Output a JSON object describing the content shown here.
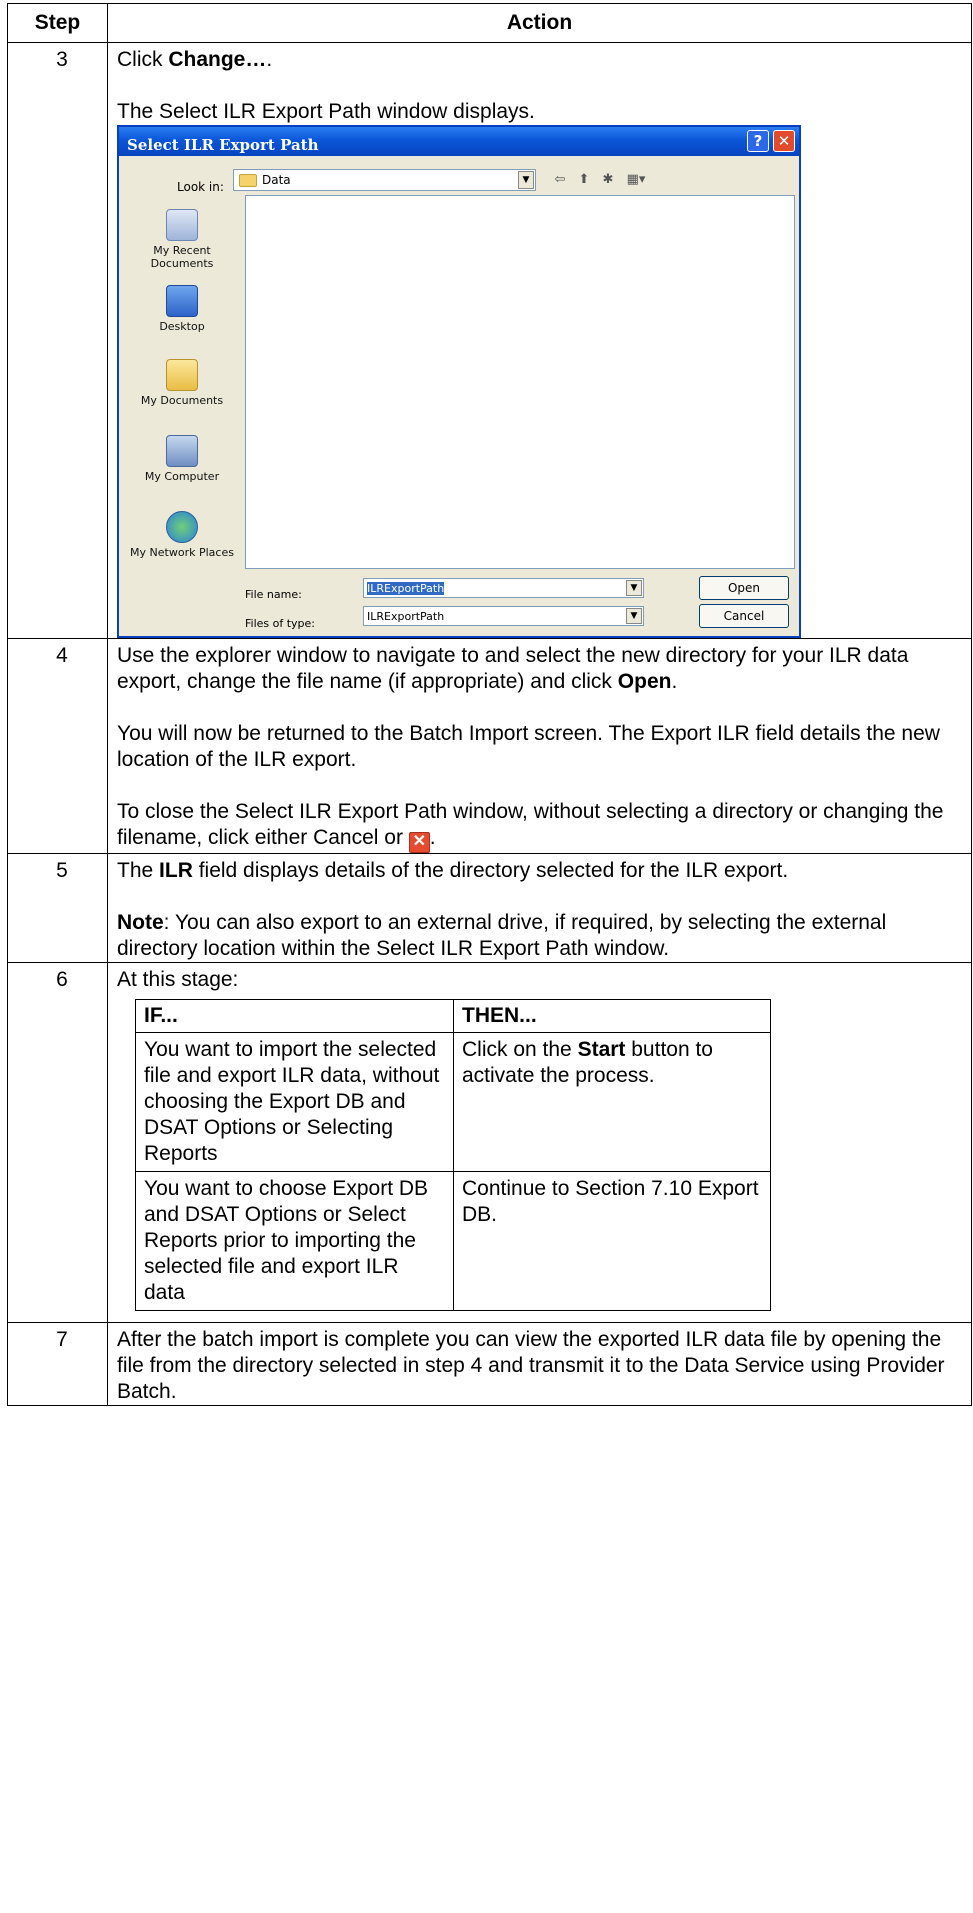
{
  "headers": {
    "step": "Step",
    "action": "Action"
  },
  "row3": {
    "step": "3",
    "click": "Click ",
    "change": "Change…",
    "period": ".",
    "displays": "The Select ILR Export Path window displays."
  },
  "dialog": {
    "title": "Select ILR Export Path",
    "help": "?",
    "close": "✕",
    "look_in_label": "Look in:",
    "look_in_value": "Data",
    "places": [
      "My Recent Documents",
      "Desktop",
      "My Documents",
      "My Computer",
      "My Network Places"
    ],
    "file_name_label": "File name:",
    "file_name_value": "ILRExportPath",
    "files_of_type_label": "Files of type:",
    "files_of_type_value": "ILRExportPath",
    "open_button": "Open",
    "cancel_button": "Cancel"
  },
  "row4": {
    "step": "4",
    "p1a": "Use the explorer window to navigate to and select the new directory for your ILR data export, change the file name (if appropriate) and click ",
    "p1b": "Open",
    "p1c": ".",
    "p2": "You will now be returned to the Batch Import screen. The Export ILR field details the new location of the ILR export.",
    "p3": "To close the Select ILR Export Path window, without selecting a directory or changing the filename, click either Cancel or ",
    "p3end": "."
  },
  "row5": {
    "step": "5",
    "p1a": "The ",
    "p1b": "ILR",
    "p1c": " field displays details of the directory selected for the ILR export.",
    "note_label": "Note",
    "note_text": ": You can also export to an external drive, if required, by selecting the external directory location within the Select ILR Export Path window."
  },
  "row6": {
    "step": "6",
    "intro": "At this stage:",
    "if_header": "IF...",
    "then_header": "THEN...",
    "r1_if": "You want to import the selected file and export ILR data, without choosing the Export DB and DSAT Options or Selecting Reports",
    "r1_then_a": "Click on the ",
    "r1_then_b": "Start",
    "r1_then_c": " button to activate the process.",
    "r2_if": "You want to choose Export DB and DSAT Options or Select Reports prior to importing the selected file and export ILR data",
    "r2_then": "Continue to Section 7.10 Export DB."
  },
  "row7": {
    "step": "7",
    "text": "After the batch import is complete you can view the exported ILR data file by opening the file from the directory selected in step 4 and transmit it to the Data Service using Provider Batch."
  }
}
